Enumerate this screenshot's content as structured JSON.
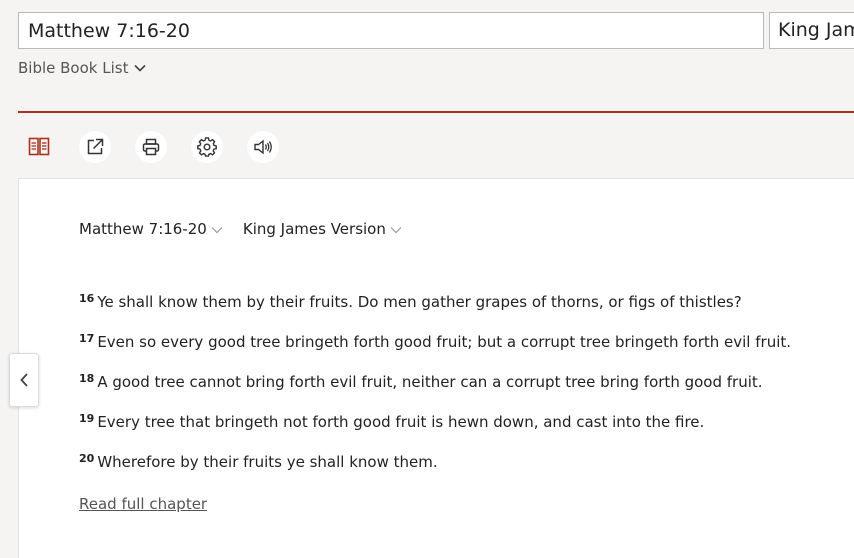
{
  "search": {
    "value": "Matthew 7:16-20"
  },
  "version_input": {
    "value": "King James Version"
  },
  "book_list": {
    "label": "Bible Book List"
  },
  "toolbar": {
    "parallel_icon": "parallel-view-icon",
    "share_icon": "share-icon",
    "print_icon": "print-icon",
    "settings_icon": "gear-icon",
    "audio_icon": "speaker-icon"
  },
  "passage": {
    "reference": "Matthew 7:16-20",
    "version": "King James Version",
    "verses": [
      {
        "num": "16",
        "text": "Ye shall know them by their fruits. Do men gather grapes of thorns, or figs of thistles?"
      },
      {
        "num": "17",
        "text": "Even so every good tree bringeth forth good fruit; but a corrupt tree bringeth forth evil fruit."
      },
      {
        "num": "18",
        "text": "A good tree cannot bring forth evil fruit, neither can a corrupt tree bring forth good fruit."
      },
      {
        "num": "19",
        "text": "Every tree that bringeth not forth good fruit is hewn down, and cast into the fire."
      },
      {
        "num": "20",
        "text": "Wherefore by their fruits ye shall know them."
      }
    ],
    "read_full_label": "Read full chapter"
  },
  "colors": {
    "accent": "#a8321f",
    "background": "#f6f4f3",
    "panel": "#ffffff"
  }
}
